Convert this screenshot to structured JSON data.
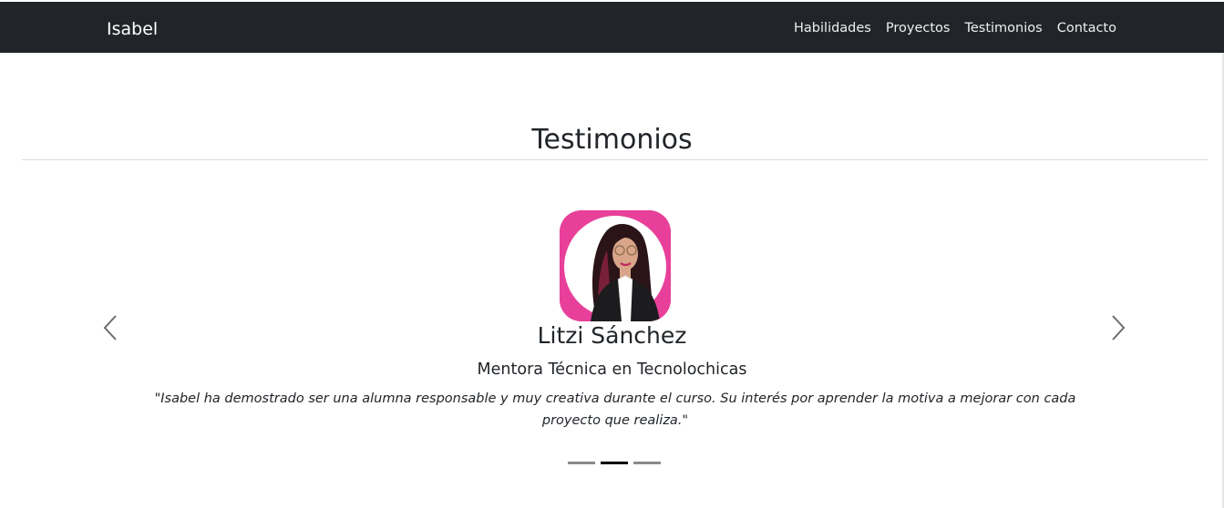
{
  "navbar": {
    "brand": "Isabel",
    "links": [
      "Habilidades",
      "Proyectos",
      "Testimonios",
      "Contacto"
    ]
  },
  "section": {
    "title": "Testimonios"
  },
  "carousel": {
    "active_index": 1,
    "slide_count": 3,
    "testimonial": {
      "name": "Litzi Sánchez",
      "role": "Mentora Técnica en Tecnolochicas",
      "quote": "\"Isabel ha demostrado ser una alumna responsable y muy creativa durante el curso. Su interés por aprender la motiva a mejorar con cada proyecto que realiza.\""
    },
    "prev_icon": "chevron-left-icon",
    "next_icon": "chevron-right-icon"
  },
  "colors": {
    "navbar_bg": "#212529",
    "avatar_bg": "#e8409a",
    "indicator_active": "#000000",
    "indicator_inactive": "#8a8a8a"
  }
}
